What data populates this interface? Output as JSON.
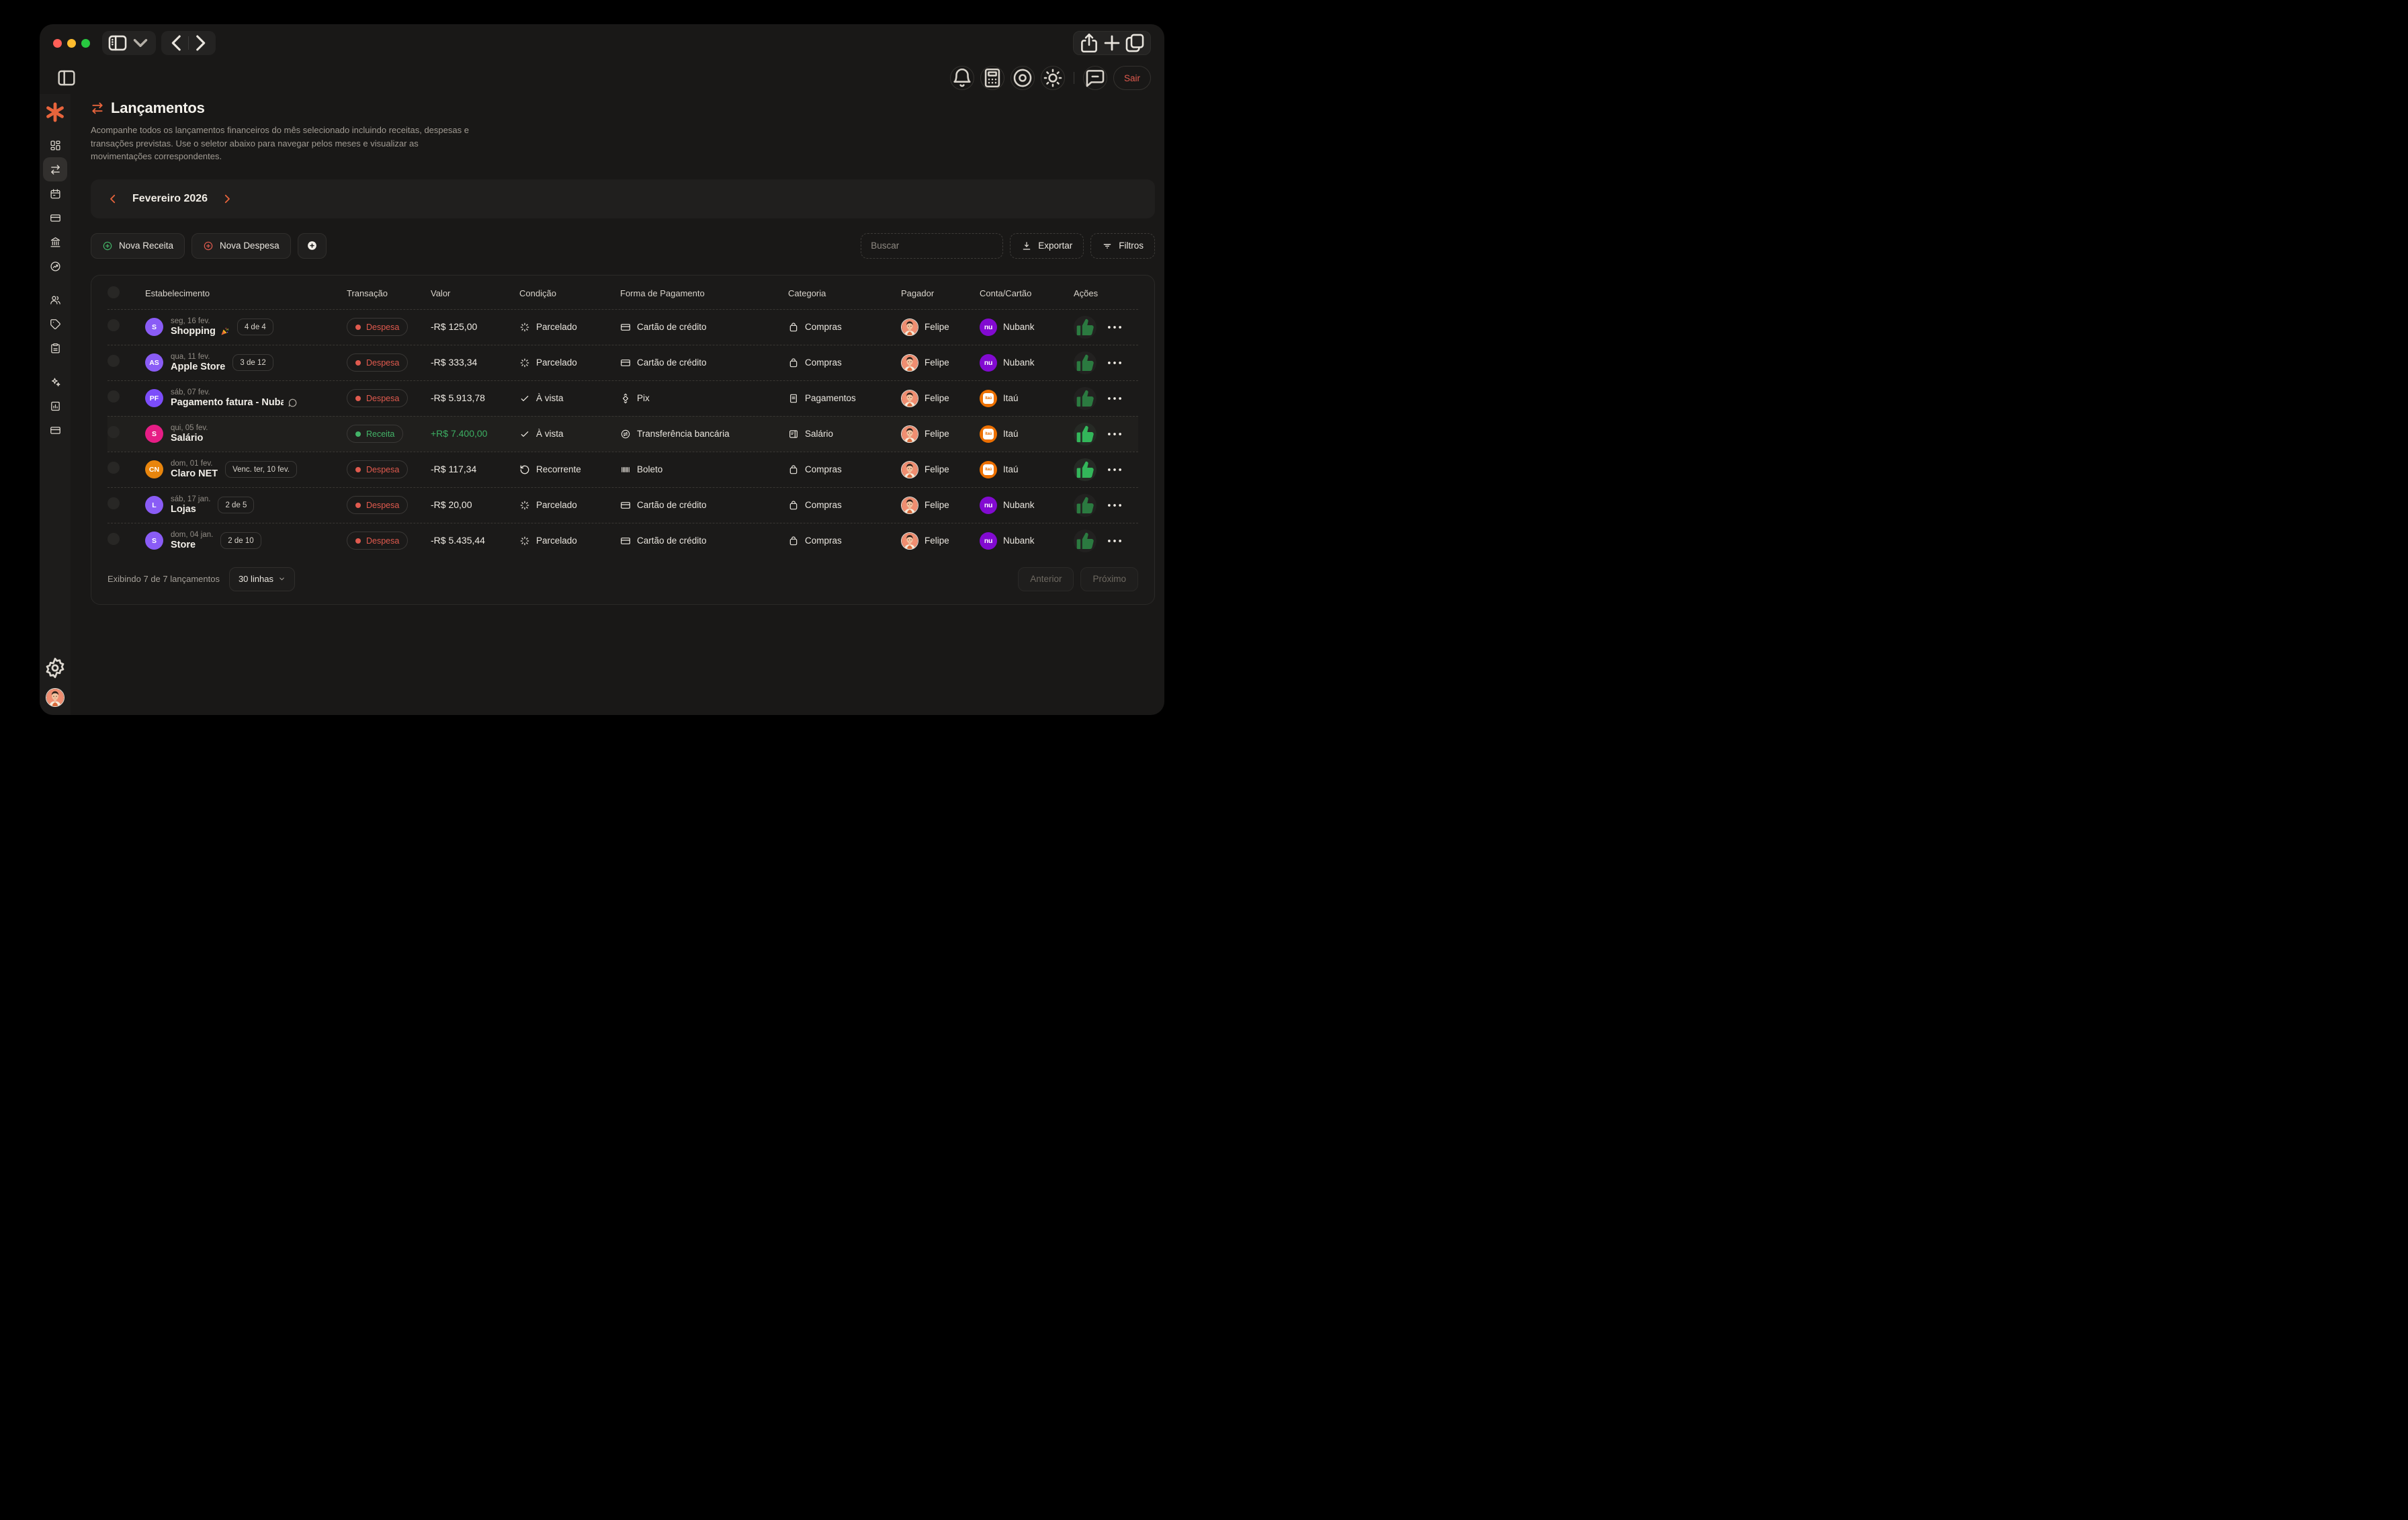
{
  "window_controls": {
    "close_color": "#ff5f57",
    "minimize_color": "#febc2e",
    "zoom_color": "#28c840"
  },
  "colors": {
    "accent": "#e8643c",
    "despesa": "#e05a4e",
    "receita": "#43b468",
    "nubank": "#820ad1",
    "itau": "#ec7000"
  },
  "sidebar": {
    "logo_icon": "asterisk-logo-icon",
    "items": [
      {
        "icon": "dashboard-icon",
        "active": false,
        "gap": false
      },
      {
        "icon": "transactions-icon",
        "active": true,
        "gap": false
      },
      {
        "icon": "calendar-icon",
        "active": false,
        "gap": false
      },
      {
        "icon": "credit-card-icon",
        "active": false,
        "gap": false
      },
      {
        "icon": "bank-icon",
        "active": false,
        "gap": false
      },
      {
        "icon": "trend-icon",
        "active": false,
        "gap": false
      },
      {
        "icon": "users-icon",
        "active": false,
        "gap": true
      },
      {
        "icon": "tag-icon",
        "active": false,
        "gap": false
      },
      {
        "icon": "clipboard-icon",
        "active": false,
        "gap": false
      },
      {
        "icon": "sparkles-icon",
        "active": false,
        "gap": true
      },
      {
        "icon": "report-icon",
        "active": false,
        "gap": false
      },
      {
        "icon": "credit-card-icon",
        "active": false,
        "gap": false
      }
    ]
  },
  "topbar": {
    "sair_label": "Sair"
  },
  "page": {
    "title": "Lançamentos",
    "description": "Acompanhe todos os lançamentos financeiros do mês selecionado incluindo receitas, despesas e transações previstas. Use o seletor abaixo para navegar pelos meses e visualizar as movimentações correspondentes."
  },
  "month_selector": {
    "label": "Fevereiro 2026"
  },
  "toolbar": {
    "nova_receita": "Nova Receita",
    "nova_despesa": "Nova Despesa",
    "search_placeholder": "Buscar",
    "exportar": "Exportar",
    "filtros": "Filtros"
  },
  "table": {
    "columns": [
      "Estabelecimento",
      "Transação",
      "Valor",
      "Condição",
      "Forma de Pagamento",
      "Categoria",
      "Pagador",
      "Conta/Cartão",
      "Ações"
    ],
    "rows": [
      {
        "date": "seg, 16 fev.",
        "name": "Shopping",
        "emoji": "party-icon",
        "badge": "4 de 4",
        "comment": false,
        "avatar_initials": "S",
        "avatar_color": "#8a5cf6",
        "type_label": "Despesa",
        "type": "despesa",
        "valor": "-R$ 125,00",
        "condicao_label": "Parcelado",
        "condicao_icon": "loader-icon",
        "forma_label": "Cartão de crédito",
        "forma_icon": "credit-card-icon",
        "categoria_label": "Compras",
        "categoria_icon": "shopping-bag-icon",
        "pagador": "Felipe",
        "conta_label": "Nubank",
        "conta_brand": "nubank",
        "confirmed": false,
        "highlight": false
      },
      {
        "date": "qua, 11 fev.",
        "name": "Apple Store",
        "emoji": null,
        "badge": "3 de 12",
        "comment": false,
        "avatar_initials": "AS",
        "avatar_color": "#8a5cf6",
        "type_label": "Despesa",
        "type": "despesa",
        "valor": "-R$ 333,34",
        "condicao_label": "Parcelado",
        "condicao_icon": "loader-icon",
        "forma_label": "Cartão de crédito",
        "forma_icon": "credit-card-icon",
        "categoria_label": "Compras",
        "categoria_icon": "shopping-bag-icon",
        "pagador": "Felipe",
        "conta_label": "Nubank",
        "conta_brand": "nubank",
        "confirmed": false,
        "highlight": false
      },
      {
        "date": "sáb, 07 fev.",
        "name": "Pagamento fatura - Nuba",
        "emoji": null,
        "badge": null,
        "comment": true,
        "avatar_initials": "PF",
        "avatar_color": "#7c4dfa",
        "type_label": "Despesa",
        "type": "despesa",
        "valor": "-R$ 5.913,78",
        "condicao_label": "À vista",
        "condicao_icon": "check-icon",
        "forma_label": "Pix",
        "forma_icon": "pix-icon",
        "categoria_label": "Pagamentos",
        "categoria_icon": "receipt-icon",
        "pagador": "Felipe",
        "conta_label": "Itaú",
        "conta_brand": "itau",
        "confirmed": false,
        "highlight": false
      },
      {
        "date": "qui, 05 fev.",
        "name": "Salário",
        "emoji": null,
        "badge": null,
        "comment": false,
        "avatar_initials": "S",
        "avatar_color": "#e61d85",
        "type_label": "Receita",
        "type": "receita",
        "valor": "+R$ 7.400,00",
        "condicao_label": "À vista",
        "condicao_icon": "check-icon",
        "forma_label": "Transferência bancária",
        "forma_icon": "bank-transfer-icon",
        "categoria_label": "Salário",
        "categoria_icon": "wallet-icon",
        "pagador": "Felipe",
        "conta_label": "Itaú",
        "conta_brand": "itau",
        "confirmed": true,
        "highlight": true
      },
      {
        "date": "dom, 01 fev.",
        "name": "Claro NET",
        "emoji": null,
        "badge": "Venc. ter, 10 fev.",
        "comment": false,
        "avatar_initials": "CN",
        "avatar_color": "#e8850d",
        "type_label": "Despesa",
        "type": "despesa",
        "valor": "-R$ 117,34",
        "condicao_label": "Recorrente",
        "condicao_icon": "rotate-icon",
        "forma_label": "Boleto",
        "forma_icon": "barcode-icon",
        "categoria_label": "Compras",
        "categoria_icon": "shopping-bag-icon",
        "pagador": "Felipe",
        "conta_label": "Itaú",
        "conta_brand": "itau",
        "confirmed": true,
        "highlight": false
      },
      {
        "date": "sáb, 17 jan.",
        "name": "Lojas",
        "emoji": null,
        "badge": "2 de 5",
        "comment": false,
        "avatar_initials": "L",
        "avatar_color": "#8a5cf6",
        "type_label": "Despesa",
        "type": "despesa",
        "valor": "-R$ 20,00",
        "condicao_label": "Parcelado",
        "condicao_icon": "loader-icon",
        "forma_label": "Cartão de crédito",
        "forma_icon": "credit-card-icon",
        "categoria_label": "Compras",
        "categoria_icon": "shopping-bag-icon",
        "pagador": "Felipe",
        "conta_label": "Nubank",
        "conta_brand": "nubank",
        "confirmed": false,
        "highlight": false
      },
      {
        "date": "dom, 04 jan.",
        "name": "Store",
        "emoji": null,
        "badge": "2 de 10",
        "comment": false,
        "avatar_initials": "S",
        "avatar_color": "#8a5cf6",
        "type_label": "Despesa",
        "type": "despesa",
        "valor": "-R$ 5.435,44",
        "condicao_label": "Parcelado",
        "condicao_icon": "loader-icon",
        "forma_label": "Cartão de crédito",
        "forma_icon": "credit-card-icon",
        "categoria_label": "Compras",
        "categoria_icon": "shopping-bag-icon",
        "pagador": "Felipe",
        "conta_label": "Nubank",
        "conta_brand": "nubank",
        "confirmed": false,
        "highlight": false
      }
    ]
  },
  "footer": {
    "summary": "Exibindo 7 de 7 lançamentos",
    "rows_select": "30 linhas",
    "anterior": "Anterior",
    "proximo": "Próximo"
  }
}
